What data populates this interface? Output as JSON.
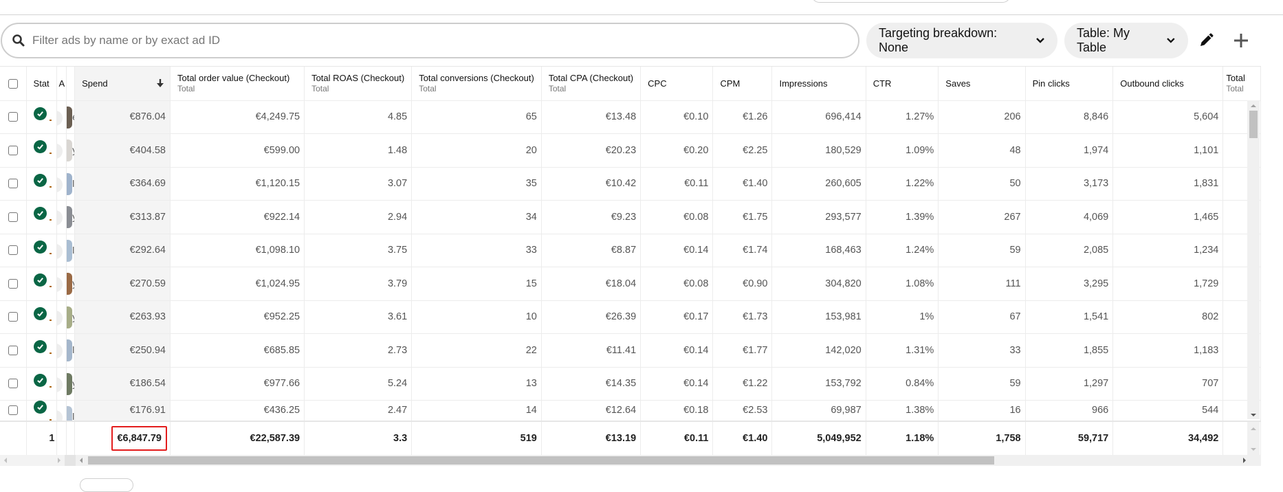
{
  "header": {
    "search": {
      "placeholder": "Filter ads by name or by exact ad ID",
      "value": ""
    },
    "targeting_breakdown_label": "Targeting breakdown: None",
    "table_select_label": "Table: My Table",
    "icons": {
      "search": "search-icon",
      "targeting_chevron": "chevron-down-icon",
      "table_chevron": "chevron-down-icon",
      "edit": "pencil-icon",
      "add": "plus-icon"
    }
  },
  "table": {
    "columns": [
      {
        "key": "select",
        "label": ""
      },
      {
        "key": "status",
        "label": "Stat"
      },
      {
        "key": "ad",
        "label": "A"
      },
      {
        "key": "thumb",
        "label": ""
      },
      {
        "key": "spend",
        "label": "Spend",
        "sort": "descending"
      },
      {
        "key": "order_value",
        "label": "Total order value (Checkout)",
        "sub": "Total"
      },
      {
        "key": "roas",
        "label": "Total ROAS (Checkout)",
        "sub": "Total"
      },
      {
        "key": "conversions",
        "label": "Total conversions (Checkout)",
        "sub": "Total"
      },
      {
        "key": "cpa",
        "label": "Total CPA (Checkout)",
        "sub": "Total"
      },
      {
        "key": "cpc",
        "label": "CPC"
      },
      {
        "key": "cpm",
        "label": "CPM"
      },
      {
        "key": "impressions",
        "label": "Impressions"
      },
      {
        "key": "ctr",
        "label": "CTR"
      },
      {
        "key": "saves",
        "label": "Saves"
      },
      {
        "key": "pin_clicks",
        "label": "Pin clicks"
      },
      {
        "key": "outbound_clicks",
        "label": "Outbound clicks"
      },
      {
        "key": "total_more",
        "label": "Total",
        "sub": "Total"
      }
    ],
    "rows": [
      {
        "status": "active",
        "name_fragment": "e",
        "thumb_color": "#6b5f52",
        "spend": "€876.04",
        "order_value": "€4,249.75",
        "roas": "4.85",
        "conversions": "65",
        "cpa": "€13.48",
        "cpc": "€0.10",
        "cpm": "€1.26",
        "impressions": "696,414",
        "ctr": "1.27%",
        "saves": "206",
        "pin_clicks": "8,846",
        "outbound_clicks": "5,604"
      },
      {
        "status": "active",
        "name_fragment": "ye",
        "thumb_color": "#d9d6d2",
        "spend": "€404.58",
        "order_value": "€599.00",
        "roas": "1.48",
        "conversions": "20",
        "cpa": "€20.23",
        "cpc": "€0.20",
        "cpm": "€2.25",
        "impressions": "180,529",
        "ctr": "1.09%",
        "saves": "48",
        "pin_clicks": "1,974",
        "outbound_clicks": "1,101"
      },
      {
        "status": "active",
        "name_fragment": "le",
        "thumb_color": "#9fb3cc",
        "spend": "€364.69",
        "order_value": "€1,120.15",
        "roas": "3.07",
        "conversions": "35",
        "cpa": "€10.42",
        "cpc": "€0.11",
        "cpm": "€1.40",
        "impressions": "260,605",
        "ctr": "1.22%",
        "saves": "50",
        "pin_clicks": "3,173",
        "outbound_clicks": "1,831"
      },
      {
        "status": "active",
        "name_fragment": "ye",
        "thumb_color": "#8a8d93",
        "spend": "€313.87",
        "order_value": "€922.14",
        "roas": "2.94",
        "conversions": "34",
        "cpa": "€9.23",
        "cpc": "€0.08",
        "cpm": "€1.75",
        "impressions": "293,577",
        "ctr": "1.39%",
        "saves": "267",
        "pin_clicks": "4,069",
        "outbound_clicks": "1,465"
      },
      {
        "status": "active",
        "name_fragment": "le",
        "thumb_color": "#a9bdd2",
        "spend": "€292.64",
        "order_value": "€1,098.10",
        "roas": "3.75",
        "conversions": "33",
        "cpa": "€8.87",
        "cpc": "€0.14",
        "cpm": "€1.74",
        "impressions": "168,463",
        "ctr": "1.24%",
        "saves": "59",
        "pin_clicks": "2,085",
        "outbound_clicks": "1,234"
      },
      {
        "status": "active",
        "name_fragment": "ye",
        "thumb_color": "#9a6a45",
        "spend": "€270.59",
        "order_value": "€1,024.95",
        "roas": "3.79",
        "conversions": "15",
        "cpa": "€18.04",
        "cpc": "€0.08",
        "cpm": "€0.90",
        "impressions": "304,820",
        "ctr": "1.08%",
        "saves": "111",
        "pin_clicks": "3,295",
        "outbound_clicks": "1,729"
      },
      {
        "status": "active",
        "name_fragment": "ye",
        "thumb_color": "#a7ad87",
        "spend": "€263.93",
        "order_value": "€952.25",
        "roas": "3.61",
        "conversions": "10",
        "cpa": "€26.39",
        "cpc": "€0.17",
        "cpm": "€1.73",
        "impressions": "153,981",
        "ctr": "1%",
        "saves": "67",
        "pin_clicks": "1,541",
        "outbound_clicks": "802"
      },
      {
        "status": "active",
        "name_fragment": "le",
        "thumb_color": "#a4b6cb",
        "spend": "€250.94",
        "order_value": "€685.85",
        "roas": "2.73",
        "conversions": "22",
        "cpa": "€11.41",
        "cpc": "€0.14",
        "cpm": "€1.77",
        "impressions": "142,020",
        "ctr": "1.31%",
        "saves": "33",
        "pin_clicks": "1,855",
        "outbound_clicks": "1,183"
      },
      {
        "status": "active",
        "name_fragment": "ye",
        "thumb_color": "#6e7a62",
        "spend": "€186.54",
        "order_value": "€977.66",
        "roas": "5.24",
        "conversions": "13",
        "cpa": "€14.35",
        "cpc": "€0.14",
        "cpm": "€1.22",
        "impressions": "153,792",
        "ctr": "0.84%",
        "saves": "59",
        "pin_clicks": "1,297",
        "outbound_clicks": "707"
      },
      {
        "status": "active",
        "name_fragment": "le",
        "thumb_color": "#b4c3d4",
        "spend": "€176.91",
        "order_value": "€436.25",
        "roas": "2.47",
        "conversions": "14",
        "cpa": "€12.64",
        "cpc": "€0.18",
        "cpm": "€2.53",
        "impressions": "69,987",
        "ctr": "1.38%",
        "saves": "16",
        "pin_clicks": "966",
        "outbound_clicks": "544"
      }
    ],
    "totals": {
      "count": "1",
      "spend": "€6,847.79",
      "order_value": "€22,587.39",
      "roas": "3.3",
      "conversions": "519",
      "cpa": "€13.19",
      "cpc": "€0.11",
      "cpm": "€1.40",
      "impressions": "5,049,952",
      "ctr": "1.18%",
      "saves": "1,758",
      "pin_clicks": "59,717",
      "outbound_clicks": "34,492"
    },
    "colors": {
      "status_active": "#0a6645",
      "highlight_border": "#e31d1d",
      "spend_column_bg": "#f4f4f4"
    }
  }
}
